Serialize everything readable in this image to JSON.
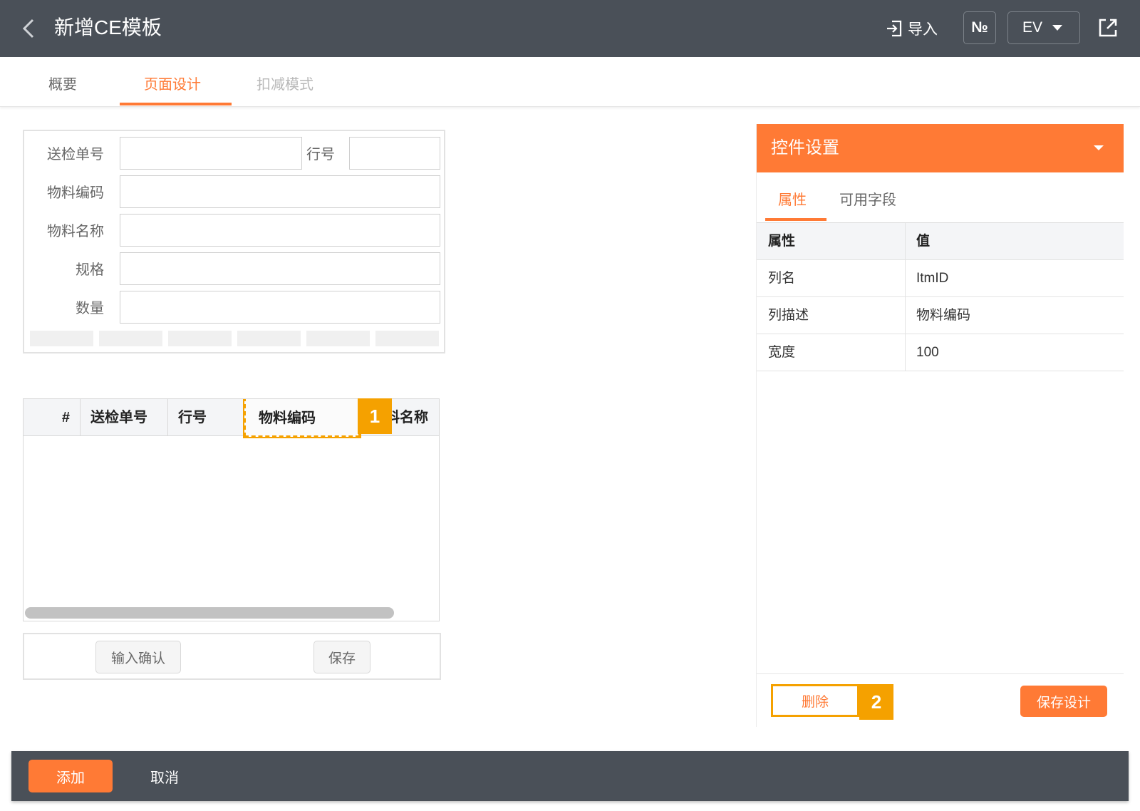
{
  "header": {
    "title": "新增CE模板",
    "import_label": "导入",
    "number_label": "№",
    "ev_label": "EV",
    "icons": {
      "back": "chevron-left-icon",
      "import": "import-icon",
      "share": "share-icon"
    }
  },
  "tabs": [
    {
      "label": "概要",
      "state": "normal"
    },
    {
      "label": "页面设计",
      "state": "active"
    },
    {
      "label": "扣减模式",
      "state": "disabled"
    }
  ],
  "form": {
    "fields": [
      {
        "label": "送检单号",
        "value": ""
      },
      {
        "label": "行号",
        "value": ""
      },
      {
        "label": "物料编码",
        "value": ""
      },
      {
        "label": "物料名称",
        "value": ""
      },
      {
        "label": "规格",
        "value": ""
      },
      {
        "label": "数量",
        "value": ""
      }
    ]
  },
  "grid": {
    "columns": [
      "#",
      "送检单号",
      "行号",
      "物料编码",
      "料名称"
    ],
    "selected_column": "物料编码",
    "rows": []
  },
  "grid_buttons": {
    "confirm_label": "输入确认",
    "save_label": "保存"
  },
  "callouts": [
    "1",
    "2"
  ],
  "settings": {
    "title": "控件设置",
    "tabs": [
      "属性",
      "可用字段"
    ],
    "active_tab": "属性",
    "table": {
      "headers": [
        "属性",
        "值"
      ],
      "rows": [
        {
          "property": "列名",
          "value": "ItmID"
        },
        {
          "property": "列描述",
          "value": "物料编码"
        },
        {
          "property": "宽度",
          "value": "100"
        }
      ]
    },
    "delete_label": "删除",
    "save_design_label": "保存设计"
  },
  "footer": {
    "add_label": "添加",
    "cancel_label": "取消"
  },
  "colors": {
    "accent": "#ff7a35",
    "highlight": "#f5a100",
    "header_bg": "#4a5058"
  }
}
